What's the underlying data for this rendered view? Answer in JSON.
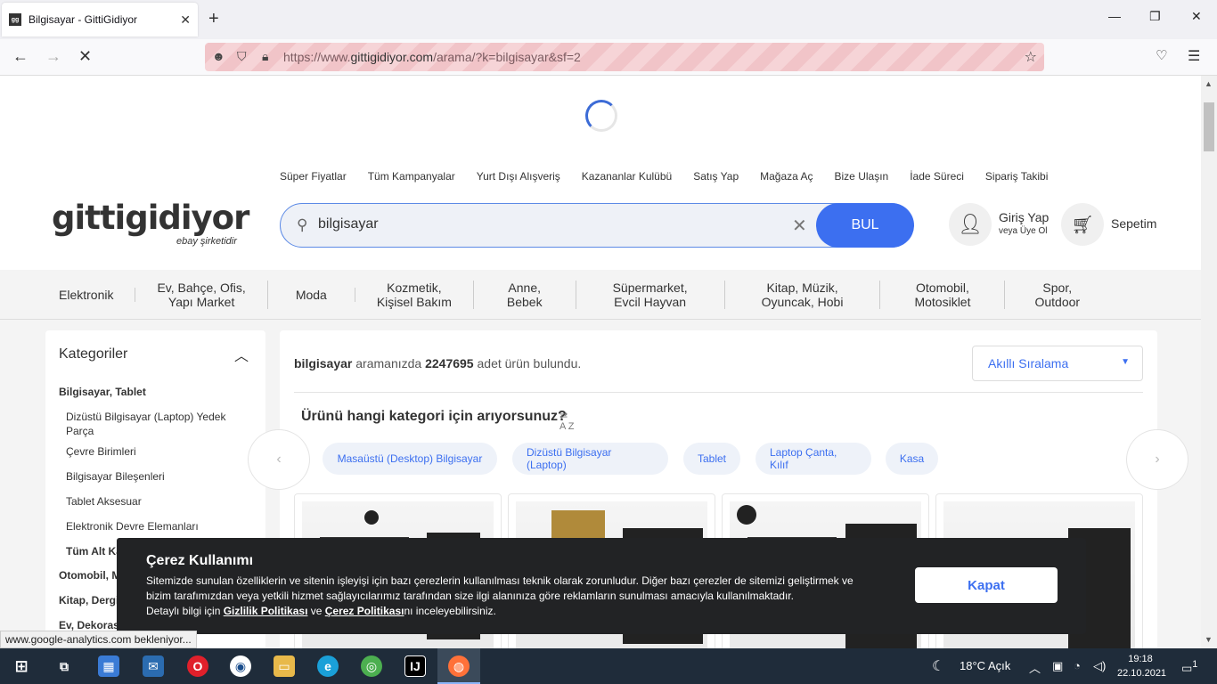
{
  "browser": {
    "tab_title": "Bilgisayar - GittiGidiyor",
    "favicon_text": "gg",
    "url_prefix": "https://www.",
    "url_host": "gittigidiyor.com",
    "url_path": "/arama/?k=bilgisayar&sf=2"
  },
  "header": {
    "top_links": [
      "Süper Fiyatlar",
      "Tüm Kampanyalar",
      "Yurt Dışı Alışveriş",
      "Kazananlar Kulübü",
      "Satış Yap",
      "Mağaza Aç",
      "Bize Ulaşın",
      "İade Süreci",
      "Sipariş Takibi"
    ],
    "logo": "gittigidiyor",
    "logo_sub": "ebay şirketidir",
    "search_value": "bilgisayar",
    "search_button": "BUL",
    "login_title": "Giriş Yap",
    "login_sub": "veya Üye Ol",
    "cart_label": "Sepetim"
  },
  "categories": [
    "Elektronik",
    "Ev, Bahçe, Ofis,\nYapı Market",
    "Moda",
    "Kozmetik,\nKişisel Bakım",
    "Anne,\nBebek",
    "Süpermarket,\nEvcil Hayvan",
    "Kitap, Müzik,\nOyuncak, Hobi",
    "Otomobil,\nMotosiklet",
    "Spor,\nOutdoor"
  ],
  "sidebar": {
    "title": "Kategoriler",
    "section": "Bilgisayar, Tablet",
    "items": [
      "Dizüstü Bilgisayar (Laptop) Yedek Parça",
      "Çevre Birimleri",
      "Bilgisayar Bileşenleri",
      "Tablet Aksesuar",
      "Elektronik Devre Elemanları",
      "Tüm Alt Kategoriler"
    ],
    "more_sections": [
      "Otomobil, Motosiklet",
      "Kitap, Dergi",
      "Ev, Dekorasyon, Bahçe"
    ]
  },
  "results": {
    "query": "bilgisayar",
    "mid": " aramanızda ",
    "count": "2247695",
    "suffix": " adet ürün bulundu.",
    "sort_label": "Akıllı Sıralama",
    "category_question": "Ürünü hangi kategori için arıyorsunuz?",
    "chips": [
      "Masaüstü (Desktop) Bilgisayar",
      "Dizüstü Bilgisayar (Laptop)",
      "Tablet",
      "Laptop Çanta, Kılıf",
      "Kasa"
    ]
  },
  "cookie": {
    "title": "Çerez Kullanımı",
    "text1": "Sitemizde sunulan özelliklerin ve sitenin işleyişi için bazı çerezlerin kullanılması teknik olarak zorunludur. Diğer bazı çerezler de sitemizi geliştirmek ve bizim tarafımızdan veya yetkili hizmet sağlayıcılarımız tarafından size ilgi alanınıza göre reklamların sunulması amacıyla kullanılmaktadır.",
    "text2_pre": "Detaylı bilgi için ",
    "link1": "Gizlilik Politikası",
    "text2_mid": " ve ",
    "link2": "Çerez Politikası",
    "text2_post": "nı inceleyebilirsiniz.",
    "button": "Kapat"
  },
  "status_text": "www.google-analytics.com bekleniyor...",
  "taskbar": {
    "weather": "18°C  Açık",
    "time": "19:18",
    "date": "22.10.2021",
    "notification_count": "1"
  },
  "colors": {
    "accent": "#3c6ff0",
    "cookie_bg": "#222325",
    "taskbar": "#1f2c3a"
  }
}
